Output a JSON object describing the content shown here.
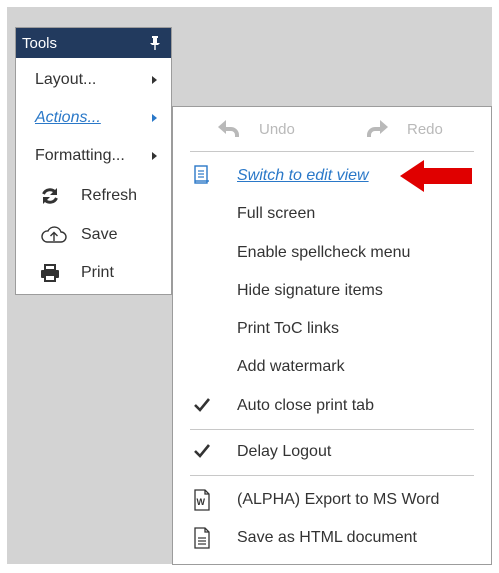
{
  "tools_menu": {
    "title": "Tools",
    "items": [
      {
        "label": "Layout...",
        "icon": "submenu-arrow"
      },
      {
        "label": "Actions...",
        "icon": "submenu-arrow",
        "active": true
      },
      {
        "label": "Formatting...",
        "icon": "submenu-arrow"
      },
      {
        "label": "Refresh",
        "icon": "refresh-icon"
      },
      {
        "label": "Save",
        "icon": "cloud-upload-icon"
      },
      {
        "label": "Print",
        "icon": "printer-icon"
      }
    ]
  },
  "actions_menu": {
    "undo_label": "Undo",
    "redo_label": "Redo",
    "items": [
      {
        "label": "Switch to edit view",
        "icon": "edit-view-icon",
        "highlighted": true
      },
      {
        "label": "Full screen"
      },
      {
        "label": "Enable spellcheck menu"
      },
      {
        "label": "Hide signature items"
      },
      {
        "label": "Print ToC links"
      },
      {
        "label": "Add watermark"
      },
      {
        "label": "Auto close print tab",
        "icon": "checkmark-icon",
        "checked": true
      },
      {
        "label": "Delay Logout",
        "icon": "checkmark-icon",
        "checked": true
      },
      {
        "label": "(ALPHA) Export to MS Word",
        "icon": "word-document-icon"
      },
      {
        "label": "Save as HTML document",
        "icon": "document-icon"
      }
    ]
  },
  "colors": {
    "header_bg": "#223a5e",
    "link_blue": "#2a78c8",
    "annotation_red": "#e00000"
  }
}
